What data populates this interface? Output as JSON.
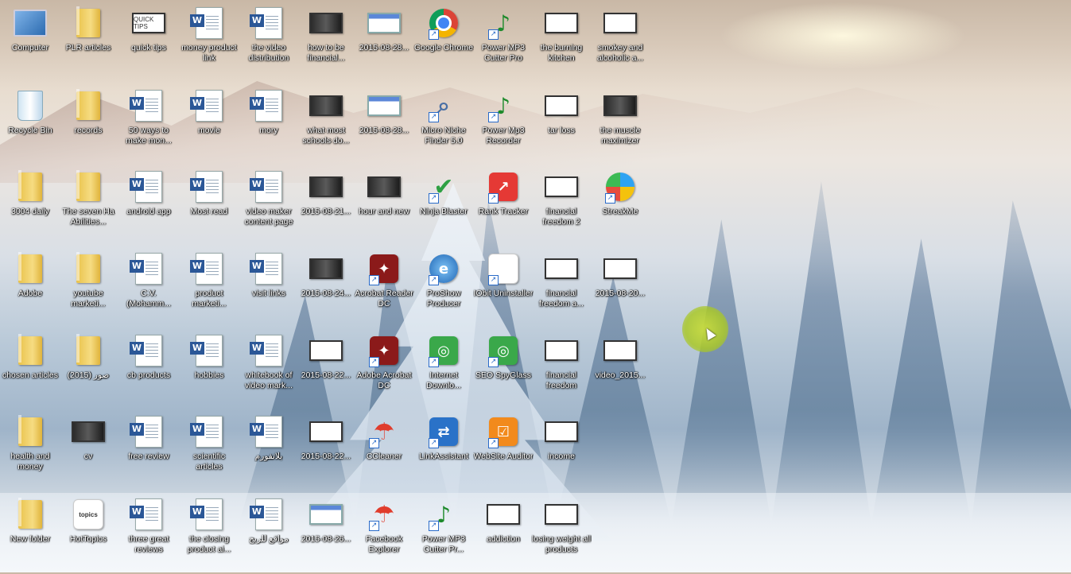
{
  "desktop": {
    "icons": [
      {
        "label": "Computer",
        "type": "computer"
      },
      {
        "label": "PLR articles",
        "type": "folder"
      },
      {
        "label": "quick tips",
        "type": "thumb-white",
        "thumb": "QUICK TIPS"
      },
      {
        "label": "money product link",
        "type": "word"
      },
      {
        "label": "the video distribution",
        "type": "word"
      },
      {
        "label": "how to be financial...",
        "type": "thumb-dark"
      },
      {
        "label": "2015-08-28...",
        "type": "thumb-blue"
      },
      {
        "label": "Google Chrome",
        "type": "app-chrome",
        "shortcut": true
      },
      {
        "label": "Power MP3 Cutter Pro",
        "type": "app-mp3",
        "shortcut": true
      },
      {
        "label": "the burning kitchen",
        "type": "thumb-white"
      },
      {
        "label": "smokey and alcoholic a...",
        "type": "thumb-white"
      },
      {
        "label": "Recycle Bin",
        "type": "recycle"
      },
      {
        "label": "records",
        "type": "folder"
      },
      {
        "label": "50 ways to make mon...",
        "type": "word"
      },
      {
        "label": "movie",
        "type": "word"
      },
      {
        "label": "mory",
        "type": "word"
      },
      {
        "label": "what most schools do...",
        "type": "thumb-dark"
      },
      {
        "label": "2015-08-28...",
        "type": "thumb-blue"
      },
      {
        "label": "Micro Niche Finder 5.0",
        "type": "app-mag",
        "shortcut": true
      },
      {
        "label": "Power Mp3 Recorder",
        "type": "app-mp3",
        "shortcut": true
      },
      {
        "label": "tar loss",
        "type": "thumb-white"
      },
      {
        "label": "the muscle maximizer",
        "type": "thumb-dark"
      },
      {
        "label": "3004 daily",
        "type": "folder"
      },
      {
        "label": "The seven Ha Abilities...",
        "type": "folder"
      },
      {
        "label": "android app",
        "type": "word"
      },
      {
        "label": "Most read",
        "type": "word"
      },
      {
        "label": "video maker content page",
        "type": "word"
      },
      {
        "label": "2015-08-21...",
        "type": "thumb-dark"
      },
      {
        "label": "hour and new",
        "type": "thumb-dark"
      },
      {
        "label": "Ninja Blaster",
        "type": "app-check",
        "shortcut": true
      },
      {
        "label": "Rank Tracker",
        "type": "app-red",
        "shortcut": true
      },
      {
        "label": "financial freedom 2",
        "type": "thumb-white"
      },
      {
        "label": "StreakMe",
        "type": "app-multi",
        "shortcut": true
      },
      {
        "label": "Adobe",
        "type": "folder"
      },
      {
        "label": "youtube marketi...",
        "type": "folder"
      },
      {
        "label": "C.V. (Mohamm...",
        "type": "word"
      },
      {
        "label": "product marketi...",
        "type": "word"
      },
      {
        "label": "visit links",
        "type": "word"
      },
      {
        "label": "2015-08-24...",
        "type": "thumb-dark"
      },
      {
        "label": "Acrobat Reader DC",
        "type": "app-pdf",
        "shortcut": true
      },
      {
        "label": "ProShow Producer",
        "type": "app-ie",
        "shortcut": true
      },
      {
        "label": "IObit Uninstaller",
        "type": "app-white",
        "shortcut": true
      },
      {
        "label": "financial freedom a...",
        "type": "thumb-white"
      },
      {
        "label": "2015-08-20...",
        "type": "thumb-white"
      },
      {
        "label": "chosen articles",
        "type": "folder"
      },
      {
        "label": "صور (2015)",
        "type": "folder"
      },
      {
        "label": "cb products",
        "type": "word"
      },
      {
        "label": "hobbies",
        "type": "word"
      },
      {
        "label": "whitebook of video mark...",
        "type": "word"
      },
      {
        "label": "2015-08-22...",
        "type": "thumb-white"
      },
      {
        "label": "Adobe Acrobat DC",
        "type": "app-pdf",
        "shortcut": true
      },
      {
        "label": "Internet Downlo...",
        "type": "app-green",
        "shortcut": true
      },
      {
        "label": "SEO SpyGlass",
        "type": "app-green",
        "shortcut": true
      },
      {
        "label": "financial freedom",
        "type": "thumb-white"
      },
      {
        "label": "video_2015...",
        "type": "thumb-white"
      },
      {
        "label": "health and money",
        "type": "folder"
      },
      {
        "label": "cv",
        "type": "thumb-dark"
      },
      {
        "label": "free review",
        "type": "word"
      },
      {
        "label": "scientific articles",
        "type": "word"
      },
      {
        "label": "بلاتفورم",
        "type": "word"
      },
      {
        "label": "2015-08-22...",
        "type": "thumb-white"
      },
      {
        "label": "CCleaner",
        "type": "app-umbrella",
        "shortcut": true
      },
      {
        "label": "LinkAssistant",
        "type": "app-blue",
        "shortcut": true
      },
      {
        "label": "WebSite Auditor",
        "type": "app-orange",
        "shortcut": true
      },
      {
        "label": "income",
        "type": "thumb-white"
      },
      {
        "label": "New folder",
        "type": "folder"
      },
      {
        "label": "HotTopics",
        "type": "app-white",
        "thumb": "topics"
      },
      {
        "label": "three great reviews",
        "type": "word"
      },
      {
        "label": "the closing product ai...",
        "type": "word"
      },
      {
        "label": "مواقع للربح",
        "type": "word"
      },
      {
        "label": "2015-08-26...",
        "type": "thumb-blue"
      },
      {
        "label": "Facebook Explorer",
        "type": "app-umbrella",
        "shortcut": true
      },
      {
        "label": "Power MP3 Cutter Pr...",
        "type": "app-mp3",
        "shortcut": true
      },
      {
        "label": "addiction",
        "type": "thumb-white"
      },
      {
        "label": "losing weight all products",
        "type": "thumb-white"
      }
    ]
  }
}
